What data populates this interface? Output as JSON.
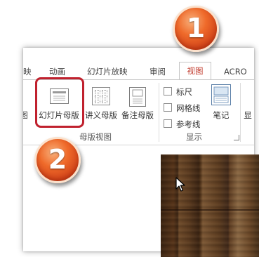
{
  "tabs": [
    {
      "label": "映",
      "active": false
    },
    {
      "label": "动画",
      "active": false
    },
    {
      "label": "幻灯片放映",
      "active": false
    },
    {
      "label": "审阅",
      "active": false
    },
    {
      "label": "视图",
      "active": true
    },
    {
      "label": "ACRO",
      "active": false
    }
  ],
  "ribbon": {
    "partial_left_label": "图",
    "slide_master_label": "幻灯片母版",
    "handout_master_label": "讲义母版",
    "notes_master_label": "备注母版",
    "master_views_group": "母版视图",
    "ruler_label": "标尺",
    "gridlines_label": "网格线",
    "guides_label": "参考线",
    "notes_label": "笔记",
    "show_group": "显示",
    "partial_right_label": "显"
  },
  "callouts": {
    "step1": "1",
    "step2": "2"
  },
  "colors": {
    "accent": "#c0392b",
    "highlight": "#c0212e",
    "badge": "#ef6a2a"
  },
  "icons": {
    "ruler_checked": false,
    "gridlines_checked": false,
    "guides_checked": false
  }
}
